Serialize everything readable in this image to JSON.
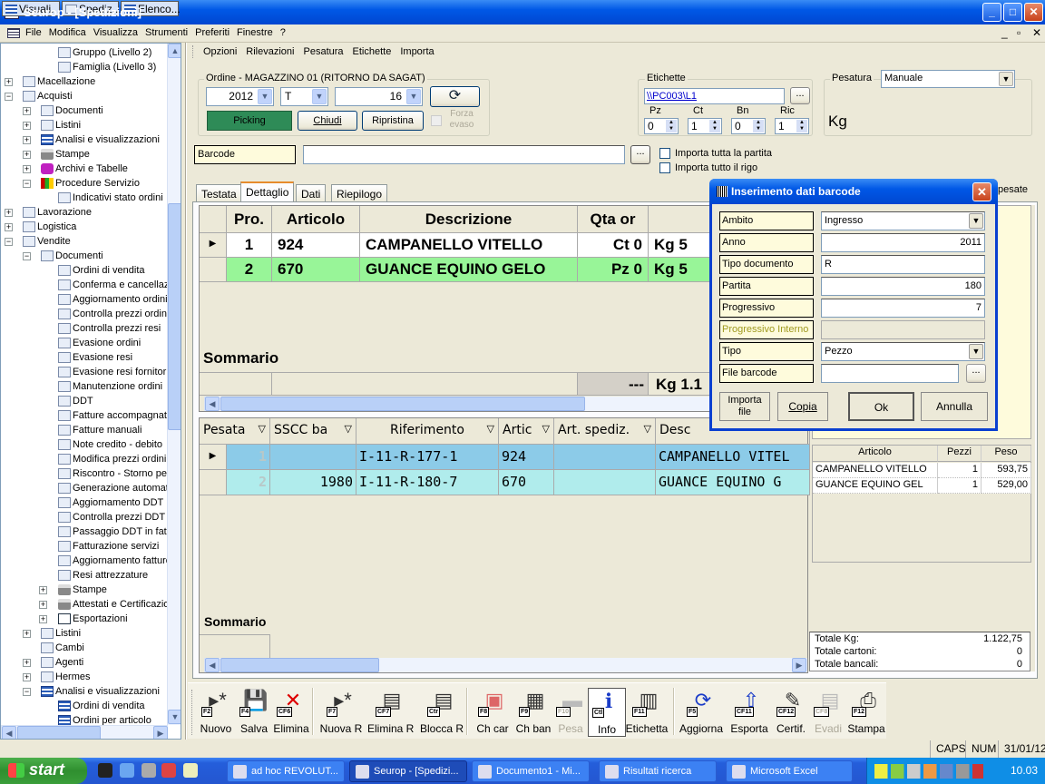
{
  "window": {
    "title": "Seurop - [Spedizioni]",
    "minimize": "_",
    "maximize": "□",
    "close": "✕"
  },
  "menu": [
    "File",
    "Modifica",
    "Visualizza",
    "Strumenti",
    "Preferiti",
    "Finestre",
    "?"
  ],
  "mdi_controls": [
    "_",
    "▫",
    "✕"
  ],
  "sidebar": {
    "items": [
      {
        "label": "Gruppo (Livello 2)",
        "level": 2,
        "exp": "",
        "icon": "form"
      },
      {
        "label": "Famiglia (Livello 3)",
        "level": 2,
        "exp": "",
        "icon": "form"
      },
      {
        "label": "Macellazione",
        "level": 0,
        "exp": "+",
        "icon": "form"
      },
      {
        "label": "Acquisti",
        "level": 0,
        "exp": "-",
        "icon": "form"
      },
      {
        "label": "Documenti",
        "level": 1,
        "exp": "+",
        "icon": "form"
      },
      {
        "label": "Listini",
        "level": 1,
        "exp": "+",
        "icon": "form"
      },
      {
        "label": "Analisi e visualizzazioni",
        "level": 1,
        "exp": "+",
        "icon": "grid"
      },
      {
        "label": "Stampe",
        "level": 1,
        "exp": "+",
        "icon": "printer"
      },
      {
        "label": "Archivi e Tabelle",
        "level": 1,
        "exp": "+",
        "icon": "books"
      },
      {
        "label": "Procedure Servizio",
        "level": 1,
        "exp": "-",
        "icon": "tools"
      },
      {
        "label": "Indicativi stato ordini",
        "level": 2,
        "exp": "",
        "icon": "form"
      },
      {
        "label": "Lavorazione",
        "level": 0,
        "exp": "+",
        "icon": "form"
      },
      {
        "label": "Logistica",
        "level": 0,
        "exp": "+",
        "icon": "form"
      },
      {
        "label": "Vendite",
        "level": 0,
        "exp": "-",
        "icon": "form"
      },
      {
        "label": "Documenti",
        "level": 1,
        "exp": "-",
        "icon": "form"
      },
      {
        "label": "Ordini di vendita",
        "level": 2,
        "exp": "",
        "icon": "form"
      },
      {
        "label": "Conferma e cancellazi",
        "level": 2,
        "exp": "",
        "icon": "form"
      },
      {
        "label": "Aggiornamento ordini -",
        "level": 2,
        "exp": "",
        "icon": "form"
      },
      {
        "label": "Controlla prezzi ordini",
        "level": 2,
        "exp": "",
        "icon": "form"
      },
      {
        "label": "Controlla prezzi resi",
        "level": 2,
        "exp": "",
        "icon": "form"
      },
      {
        "label": "Evasione ordini",
        "level": 2,
        "exp": "",
        "icon": "form"
      },
      {
        "label": "Evasione resi",
        "level": 2,
        "exp": "",
        "icon": "form"
      },
      {
        "label": "Evasione resi fornitori",
        "level": 2,
        "exp": "",
        "icon": "form"
      },
      {
        "label": "Manutenzione ordini",
        "level": 2,
        "exp": "",
        "icon": "form"
      },
      {
        "label": "DDT",
        "level": 2,
        "exp": "",
        "icon": "form"
      },
      {
        "label": "Fatture accompagnato",
        "level": 2,
        "exp": "",
        "icon": "form"
      },
      {
        "label": "Fatture manuali",
        "level": 2,
        "exp": "",
        "icon": "form"
      },
      {
        "label": "Note credito - debito",
        "level": 2,
        "exp": "",
        "icon": "form"
      },
      {
        "label": "Modifica prezzi ordini -",
        "level": 2,
        "exp": "",
        "icon": "form"
      },
      {
        "label": "Riscontro - Storno pes",
        "level": 2,
        "exp": "",
        "icon": "form"
      },
      {
        "label": "Generazione automati",
        "level": 2,
        "exp": "",
        "icon": "form"
      },
      {
        "label": "Aggiornamento DDT",
        "level": 2,
        "exp": "",
        "icon": "form"
      },
      {
        "label": "Controlla prezzi DDT",
        "level": 2,
        "exp": "",
        "icon": "form"
      },
      {
        "label": "Passaggio DDT in fatt",
        "level": 2,
        "exp": "",
        "icon": "form"
      },
      {
        "label": "Fatturazione servizi",
        "level": 2,
        "exp": "",
        "icon": "form"
      },
      {
        "label": "Aggiornamento fatture",
        "level": 2,
        "exp": "",
        "icon": "form"
      },
      {
        "label": "Resi attrezzature",
        "level": 2,
        "exp": "",
        "icon": "form"
      },
      {
        "label": "Stampe",
        "level": 2,
        "exp": "+",
        "icon": "printer"
      },
      {
        "label": "Attestati e Certificazion",
        "level": 2,
        "exp": "+",
        "icon": "printer"
      },
      {
        "label": "Esportazioni",
        "level": 2,
        "exp": "+",
        "icon": "export"
      },
      {
        "label": "Listini",
        "level": 1,
        "exp": "+",
        "icon": "form"
      },
      {
        "label": "Cambi",
        "level": 1,
        "exp": "",
        "icon": "form"
      },
      {
        "label": "Agenti",
        "level": 1,
        "exp": "+",
        "icon": "form"
      },
      {
        "label": "Hermes",
        "level": 1,
        "exp": "+",
        "icon": "form"
      },
      {
        "label": "Analisi e visualizzazioni",
        "level": 1,
        "exp": "-",
        "icon": "grid"
      },
      {
        "label": "Ordini di vendita",
        "level": 2,
        "exp": "",
        "icon": "grid"
      },
      {
        "label": "Ordini per articolo",
        "level": 2,
        "exp": "",
        "icon": "grid"
      }
    ]
  },
  "submenu": [
    "Opzioni",
    "Rilevazioni",
    "Pesatura",
    "Etichette",
    "Importa"
  ],
  "order": {
    "title": "Ordine - MAGAZZINO 01 (RITORNO DA SAGAT)",
    "year": "2012",
    "series": "T",
    "number": "16",
    "picking": "Picking",
    "chiudi": "Chiudi",
    "ripristina": "Ripristina",
    "forza_evaso": "Forza evaso"
  },
  "etichette": {
    "title": "Etichette",
    "printer": "\\\\PC003\\L1",
    "browse": "...",
    "spinners": [
      {
        "label": "Pz",
        "value": "0"
      },
      {
        "label": "Ct",
        "value": "1"
      },
      {
        "label": "Bn",
        "value": "0"
      },
      {
        "label": "Ric",
        "value": "1"
      }
    ]
  },
  "pesatura": {
    "title": "Pesatura",
    "mode": "Manuale",
    "unit": "Kg"
  },
  "barcode": {
    "label": "Barcode",
    "value": "",
    "browse": "...",
    "import_all_lot": "Importa tutta la partita",
    "import_all_row": "Importa tutto il rigo"
  },
  "tabs": [
    "Testata",
    "Dettaglio",
    "Dati",
    "Riepilogo"
  ],
  "right_tab_fragment": "pesate",
  "upper_grid": {
    "columns": [
      "Pro.",
      "Articolo",
      "Descrizione",
      "Qta or",
      "Qtà p"
    ],
    "rows": [
      {
        "pro": "1",
        "articolo": "924",
        "descrizione": "CAMPANELLO VITELLO",
        "qta_or": "Ct 0",
        "qta_p": "Kg 5"
      },
      {
        "pro": "2",
        "articolo": "670",
        "descrizione": "GUANCE EQUINO GELO",
        "qta_or": "Pz 0",
        "qta_p": "Kg 5"
      }
    ],
    "summary_label": "Sommario",
    "summary_qta_or": "---",
    "summary_qta_p": "Kg 1.1"
  },
  "lower_grid": {
    "columns": [
      "Pesata",
      "SSCC ba",
      "Riferimento",
      "Artic",
      "Art. spediz.",
      "Desc"
    ],
    "rows": [
      {
        "pesata": "1",
        "sscc": "",
        "riferimento": "I-11-R-177-1",
        "artic": "924",
        "spediz": "",
        "desc": "CAMPANELLO VITEL"
      },
      {
        "pesata": "2",
        "sscc": "1980",
        "riferimento": "I-11-R-180-7",
        "artic": "670",
        "spediz": "",
        "desc": "GUANCE EQUINO G"
      }
    ],
    "summary_label": "Sommario"
  },
  "right_list": {
    "columns": [
      "Articolo",
      "Pezzi",
      "Peso"
    ],
    "rows": [
      {
        "articolo": "CAMPANELLO VITELLO",
        "pezzi": "1",
        "peso": "593,75"
      },
      {
        "articolo": "GUANCE EQUINO GEL",
        "pezzi": "1",
        "peso": "529,00"
      }
    ],
    "totals": [
      {
        "label": "Totale Kg:",
        "value": "1.122,75"
      },
      {
        "label": "Totale cartoni:",
        "value": "0"
      },
      {
        "label": "Totale bancali:",
        "value": "0"
      }
    ]
  },
  "toolbar": [
    {
      "label": "Nuovo",
      "key": "F2",
      "icon": "new-row-icon",
      "glyph": "▸*",
      "enabled": true
    },
    {
      "label": "Salva",
      "key": "F4",
      "icon": "save-icon",
      "glyph": "💾",
      "enabled": true
    },
    {
      "label": "Elimina",
      "key": "CF6",
      "icon": "delete-icon",
      "glyph": "✕",
      "enabled": true
    },
    {
      "label": "Nuova R",
      "key": "F7",
      "icon": "new-row-icon",
      "glyph": "▸*",
      "enabled": true
    },
    {
      "label": "Elimina R",
      "key": "CF7",
      "icon": "delete-row-icon",
      "glyph": "▤",
      "enabled": true
    },
    {
      "label": "Blocca R",
      "key": "Ctr",
      "icon": "lock-row-icon",
      "glyph": "▤",
      "enabled": true
    },
    {
      "label": "Ch car",
      "key": "F8",
      "icon": "close-cart-icon",
      "glyph": "▣",
      "enabled": true
    },
    {
      "label": "Ch ban",
      "key": "F9",
      "icon": "pallet-icon",
      "glyph": "▦",
      "enabled": true
    },
    {
      "label": "Pesa",
      "key": "F10",
      "icon": "scale-icon",
      "glyph": "▬",
      "enabled": false
    },
    {
      "label": "Info",
      "key": "Ctl",
      "icon": "info-icon",
      "glyph": "ℹ",
      "enabled": true,
      "pressed": true
    },
    {
      "label": "Etichetta",
      "key": "F11",
      "icon": "label-icon",
      "glyph": "▥",
      "enabled": true
    },
    {
      "label": "Aggiorna",
      "key": "F5",
      "icon": "refresh-icon",
      "glyph": "⟳",
      "enabled": true
    },
    {
      "label": "Esporta",
      "key": "CF11",
      "icon": "export-icon",
      "glyph": "⇧",
      "enabled": true
    },
    {
      "label": "Certif.",
      "key": "CF12",
      "icon": "certificate-icon",
      "glyph": "✎",
      "enabled": true
    },
    {
      "label": "Evadi",
      "key": "CF8",
      "icon": "fulfill-icon",
      "glyph": "▤",
      "enabled": false
    },
    {
      "label": "Stampa",
      "key": "F12",
      "icon": "printer-icon",
      "glyph": "⎙",
      "enabled": true
    }
  ],
  "dialog": {
    "title": "Inserimento dati barcode",
    "fields": [
      {
        "label": "Ambito",
        "value": "Ingresso",
        "type": "combo"
      },
      {
        "label": "Anno",
        "value": "2011",
        "type": "num"
      },
      {
        "label": "Tipo documento",
        "value": "R",
        "type": "text"
      },
      {
        "label": "Partita",
        "value": "180",
        "type": "num"
      },
      {
        "label": "Progressivo",
        "value": "7",
        "type": "num"
      },
      {
        "label": "Progressivo Interno",
        "value": "",
        "type": "disabled"
      },
      {
        "label": "Tipo",
        "value": "Pezzo",
        "type": "combo"
      },
      {
        "label": "File barcode",
        "value": "",
        "type": "file"
      }
    ],
    "browse": "...",
    "import_file": "Importa file",
    "copy": "Copia",
    "ok": "Ok",
    "cancel": "Annulla"
  },
  "bottom_tabs": [
    "Visuali...",
    "Spediz...",
    "Elenco..."
  ],
  "status": {
    "caps": "CAPS",
    "num": "NUM",
    "date": "31/01/12"
  },
  "taskbar": {
    "start": "start",
    "tasks": [
      {
        "label": "ad hoc REVOLUT..."
      },
      {
        "label": "Seurop - [Spedizi...",
        "active": true
      },
      {
        "label": "Documento1 - Mi..."
      },
      {
        "label": "Risultati ricerca"
      },
      {
        "label": "Microsoft Excel"
      }
    ],
    "clock": "10.03"
  }
}
